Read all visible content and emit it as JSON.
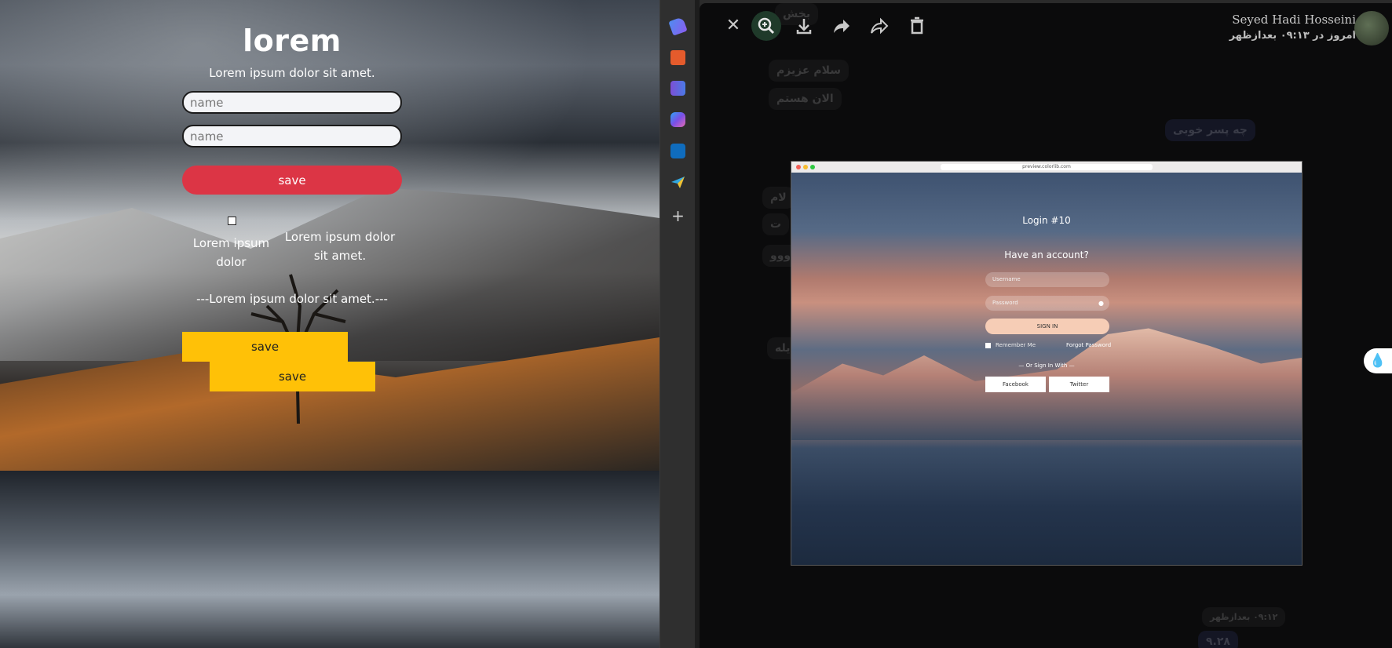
{
  "left_page": {
    "title": "lorem",
    "subtitle": "Lorem ipsum dolor sit amet.",
    "input1_placeholder": "name",
    "input2_placeholder": "name",
    "save_red_label": "save",
    "checkbox_label_a": "Lorem ipsum dolor",
    "checkbox_label_b": "Lorem ipsum dolor sit amet.",
    "divider_text": "---Lorem ipsum dolor sit amet.---",
    "save_yellow_1_label": "save",
    "save_yellow_2_label": "save",
    "colors": {
      "red_button": "#dc3545",
      "yellow_button": "#ffc107"
    }
  },
  "edge_sidebar": {
    "icons": [
      "tag-icon",
      "briefcase-icon",
      "chess-piece-icon",
      "copilot-icon",
      "outlook-icon",
      "send-icon"
    ],
    "add_icon": "plus-icon"
  },
  "viewer": {
    "toolbar_icons": [
      "close-icon",
      "zoom-in-icon",
      "download-icon",
      "forward-icon",
      "share-icon",
      "delete-icon"
    ],
    "author_name": "Seyed Hadi Hosseini",
    "author_time": "امروز در ۰۹:۱۳ بعدازظهر",
    "background_messages": [
      "بخش",
      "سلام عزیزم",
      "الان هستم",
      "چه پسر خوبی",
      "لام",
      "ت",
      "ووو",
      "یله",
      "۰۹:۱۲ بعدازظهر",
      "۹.۲۸"
    ],
    "screenshot": {
      "url": "preview.colorlib.com",
      "title": "Login #10",
      "heading": "Have an account?",
      "username_placeholder": "Username",
      "password_placeholder": "Password",
      "signin_label": "SIGN IN",
      "remember_label": "Remember Me",
      "forgot_label": "Forgot Password",
      "or_label": "— Or Sign In With —",
      "facebook_label": "Facebook",
      "twitter_label": "Twitter"
    }
  },
  "floating_button_icon": "water-drop-icon"
}
